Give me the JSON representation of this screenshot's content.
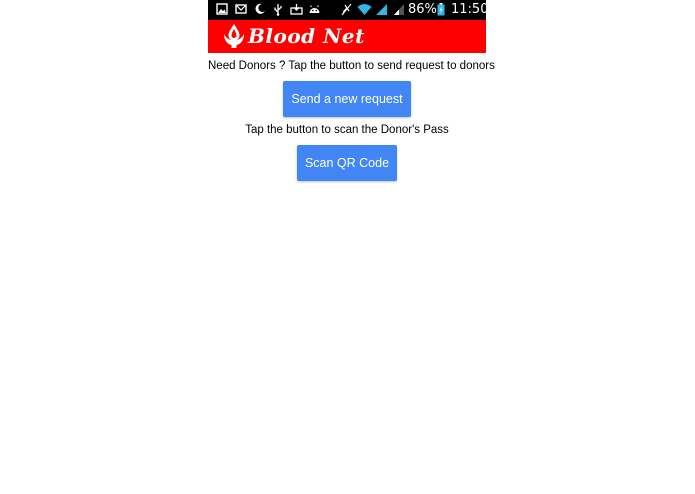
{
  "status_bar": {
    "battery_percent": "86%",
    "time": "11:50",
    "icons": [
      "image-icon",
      "mail-icon",
      "moon-icon",
      "usb-icon",
      "download-icon",
      "android-icon",
      "mute-icon",
      "wifi-icon",
      "signal-icon",
      "battery-icon"
    ]
  },
  "header": {
    "title": "Blood Net",
    "logo_icon": "blood-drop-hand-icon",
    "color": "#ff0000"
  },
  "main": {
    "request_prompt": "Need Donors ? Tap the button to send request to donors",
    "request_button": "Send a new request",
    "scan_prompt": "Tap the button to scan the Donor's Pass",
    "scan_button": "Scan QR Code",
    "button_color": "#4285f4"
  }
}
